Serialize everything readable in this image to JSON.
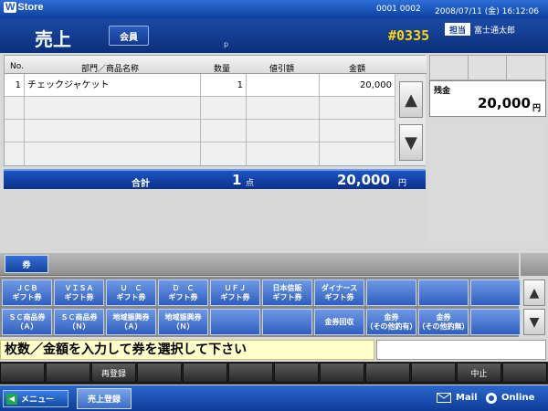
{
  "titlebar": {
    "app_name": "Store",
    "terminal": "0001 0002",
    "datetime": "2008/07/11 (金) 16:12:06"
  },
  "header": {
    "title": "売上",
    "member_label": "会員",
    "p_mark": "p",
    "receipt_no": "#0335",
    "staff_label": "担当",
    "staff_name": "富士通太郎"
  },
  "table": {
    "headers": {
      "no": "No.",
      "item": "部門／商品名称",
      "qty": "数量",
      "discount": "値引額",
      "amount": "金額"
    },
    "rows": [
      {
        "no": "1",
        "item": "チェックジャケット",
        "qty": "1",
        "discount": "",
        "amount": "20,000"
      }
    ]
  },
  "total": {
    "label": "合計",
    "count": "1",
    "count_unit": "点",
    "amount": "20,000",
    "amount_unit": "円"
  },
  "balance": {
    "label": "残金",
    "amount": "20,000",
    "unit": "円"
  },
  "tab": {
    "label": "券"
  },
  "vouchers": {
    "row1": [
      "ＪＣＢ\nギフト券",
      "ＶＩＳＡ\nギフト券",
      "Ｕ　Ｃ\nギフト券",
      "Ｄ　Ｃ\nギフト券",
      "ＵＦＪ\nギフト券",
      "日本信販\nギフト券",
      "ダイナース\nギフト券",
      "",
      "",
      ""
    ],
    "row2": [
      "ＳＣ商品券\n（Ａ）",
      "ＳＣ商品券\n（Ｎ）",
      "地域振興券\n（Ａ）",
      "地域振興券\n（Ｎ）",
      "",
      "",
      "金券回収",
      "金券\n（その他釣有）",
      "金券\n（その他釣無）",
      ""
    ]
  },
  "message": "枚数／金額を入力して券を選択して下さい",
  "function_keys": [
    "",
    "",
    "再登録",
    "",
    "",
    "",
    "",
    "",
    "",
    "",
    "中止",
    ""
  ],
  "statusbar": {
    "menu_label": "メニュー",
    "task_label": "売上登録",
    "mail_label": "Mail",
    "online_label": "Online"
  }
}
